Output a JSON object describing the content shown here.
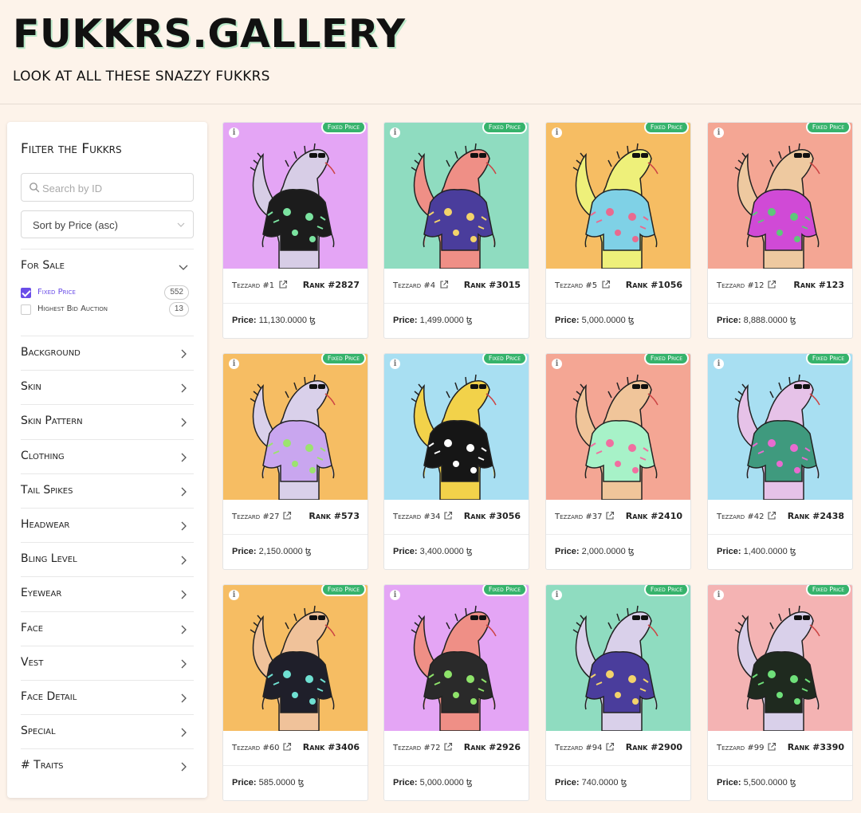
{
  "header": {
    "title": "FUKKRS.GALLERY",
    "tagline": "LOOK AT ALL THESE SNAZZY FUKKRS"
  },
  "sidebar": {
    "title": "Filter the Fukkrs",
    "search_placeholder": "Search by ID",
    "sort_value": "Sort by Price (asc)",
    "for_sale": {
      "label": "For Sale",
      "options": [
        {
          "label": "Fixed Price",
          "count": "552",
          "checked": true
        },
        {
          "label": "Highest Bid Auction",
          "count": "13",
          "checked": false
        }
      ]
    },
    "filters": [
      "Background",
      "Skin",
      "Skin Pattern",
      "Clothing",
      "Tail Spikes",
      "Headwear",
      "Bling Level",
      "Eyewear",
      "Face",
      "Vest",
      "Face Detail",
      "Special",
      "# Traits"
    ]
  },
  "price_label": "Price:",
  "currency_symbol": "ꜩ",
  "badge_label": "Fixed Price",
  "cards": [
    {
      "name": "Tezzard #1",
      "rank": "Rank #2827",
      "price": "11,130.0000",
      "bg": "#e4a5f5",
      "skin": "#d7cde6",
      "shirt": "#1c1c1c",
      "accent": "#7be3a0"
    },
    {
      "name": "Tezzard #4",
      "rank": "Rank #3015",
      "price": "1,499.0000",
      "bg": "#8fdcc0",
      "skin": "#ef8f86",
      "shirt": "#4a3d9c",
      "accent": "#f3d36b"
    },
    {
      "name": "Tezzard #5",
      "rank": "Rank #1056",
      "price": "5,000.0000",
      "bg": "#f6bd63",
      "skin": "#eef07a",
      "shirt": "#7fd1e6",
      "accent": "#e86b8f"
    },
    {
      "name": "Tezzard #12",
      "rank": "Rank #123",
      "price": "8,888.0000",
      "bg": "#f4a694",
      "skin": "#eec9a0",
      "shirt": "#d04ad6",
      "accent": "#5ec77a"
    },
    {
      "name": "Tezzard #27",
      "rank": "Rank #573",
      "price": "2,150.0000",
      "bg": "#f6bd63",
      "skin": "#d9d0ea",
      "shirt": "#c9a6ef",
      "accent": "#9be36f"
    },
    {
      "name": "Tezzard #34",
      "rank": "Rank #3056",
      "price": "3,400.0000",
      "bg": "#a8dff2",
      "skin": "#f2d24a",
      "shirt": "#161616",
      "accent": "#ffffff"
    },
    {
      "name": "Tezzard #37",
      "rank": "Rank #2410",
      "price": "2,000.0000",
      "bg": "#f4a694",
      "skin": "#f0c59a",
      "shirt": "#a7f2c8",
      "accent": "#f06fa0"
    },
    {
      "name": "Tezzard #42",
      "rank": "Rank #2438",
      "price": "1,400.0000",
      "bg": "#a8dff2",
      "skin": "#e6c2e8",
      "shirt": "#3f9a7e",
      "accent": "#e86bd0"
    },
    {
      "name": "Tezzard #60",
      "rank": "Rank #3406",
      "price": "585.0000",
      "bg": "#f6bd63",
      "skin": "#f0c29a",
      "shirt": "#1f1f2a",
      "accent": "#6fe0d2"
    },
    {
      "name": "Tezzard #72",
      "rank": "Rank #2926",
      "price": "5,000.0000",
      "bg": "#e4a5f5",
      "skin": "#ef8f86",
      "shirt": "#2a2a2a",
      "accent": "#8ee36a"
    },
    {
      "name": "Tezzard #94",
      "rank": "Rank #2900",
      "price": "740.0000",
      "bg": "#8fdcc0",
      "skin": "#d9d0ea",
      "shirt": "#4a3d9c",
      "accent": "#f3d36b"
    },
    {
      "name": "Tezzard #99",
      "rank": "Rank #3390",
      "price": "5,500.0000",
      "bg": "#f4b3b3",
      "skin": "#d9d0ea",
      "shirt": "#1f2a1f",
      "accent": "#6fe07a"
    }
  ]
}
